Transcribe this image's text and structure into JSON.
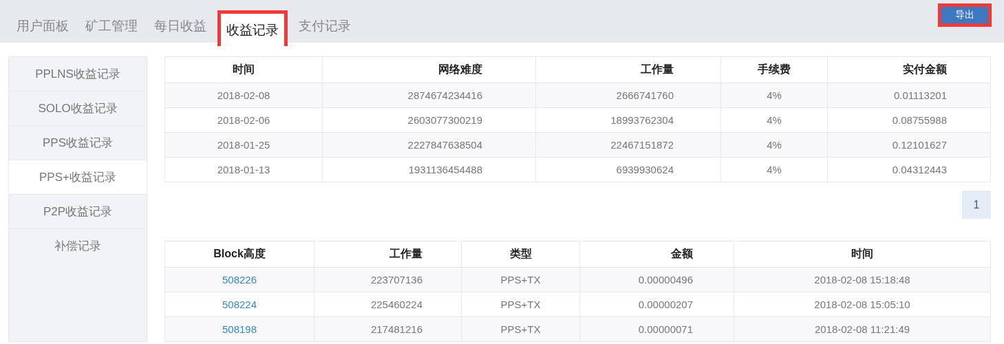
{
  "tabs": [
    {
      "label": "用户面板",
      "selected": false,
      "highlighted": false
    },
    {
      "label": "矿工管理",
      "selected": false,
      "highlighted": false
    },
    {
      "label": "每日收益",
      "selected": false,
      "highlighted": false
    },
    {
      "label": "收益记录",
      "selected": true,
      "highlighted": true
    },
    {
      "label": "支付记录",
      "selected": false,
      "highlighted": false
    }
  ],
  "export_button": {
    "label": "导出",
    "highlighted": true
  },
  "sidebar": {
    "items": [
      {
        "label": "PPLNS收益记录",
        "selected": false
      },
      {
        "label": "SOLO收益记录",
        "selected": false
      },
      {
        "label": "PPS收益记录",
        "selected": false
      },
      {
        "label": "PPS+收益记录",
        "selected": true
      },
      {
        "label": "P2P收益记录",
        "selected": false
      },
      {
        "label": "补偿记录",
        "selected": false
      }
    ]
  },
  "earnings_table": {
    "columns": [
      "时间",
      "网络难度",
      "工作量",
      "手续费",
      "实付金额"
    ],
    "rows": [
      [
        "2018-02-08",
        "2874674234416",
        "2666741760",
        "4%",
        "0.01113201"
      ],
      [
        "2018-02-06",
        "2603077300219",
        "18993762304",
        "4%",
        "0.08755988"
      ],
      [
        "2018-01-25",
        "2227847638504",
        "22467151872",
        "4%",
        "0.12101627"
      ],
      [
        "2018-01-13",
        "1931136454488",
        "6939930624",
        "4%",
        "0.04312443"
      ]
    ]
  },
  "pagination": {
    "pages": [
      {
        "label": "1",
        "selected": true
      }
    ]
  },
  "blocks_table": {
    "columns": [
      "Block高度",
      "工作量",
      "类型",
      "金额",
      "时间"
    ],
    "rows": [
      [
        "508226",
        "223707136",
        "PPS+TX",
        "0.00000496",
        "2018-02-08 15:18:48"
      ],
      [
        "508224",
        "225460224",
        "PPS+TX",
        "0.00000207",
        "2018-02-08 15:05:10"
      ],
      [
        "508198",
        "217481216",
        "PPS+TX",
        "0.00000071",
        "2018-02-08 11:21:49"
      ]
    ]
  }
}
